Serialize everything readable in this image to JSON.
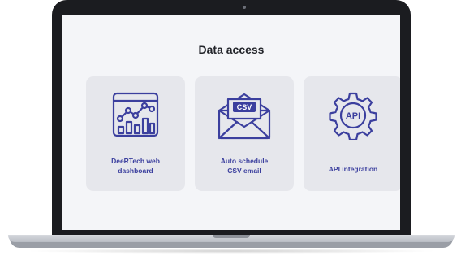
{
  "page": {
    "title": "Data access"
  },
  "cards": [
    {
      "label_line1": "DeeRTech web",
      "label_line2": "dashboard",
      "icon": "dashboard-chart-icon"
    },
    {
      "label_line1": "Auto schedule",
      "label_line2": "CSV email",
      "icon": "csv-envelope-icon",
      "icon_text": "CSV"
    },
    {
      "label": "API integration",
      "icon": "api-gear-icon",
      "icon_text": "API"
    }
  ],
  "colors": {
    "accent": "#3b3f9e",
    "card_bg": "#e6e7ec",
    "screen_bg": "#f4f5f8",
    "bezel": "#1b1c20"
  }
}
